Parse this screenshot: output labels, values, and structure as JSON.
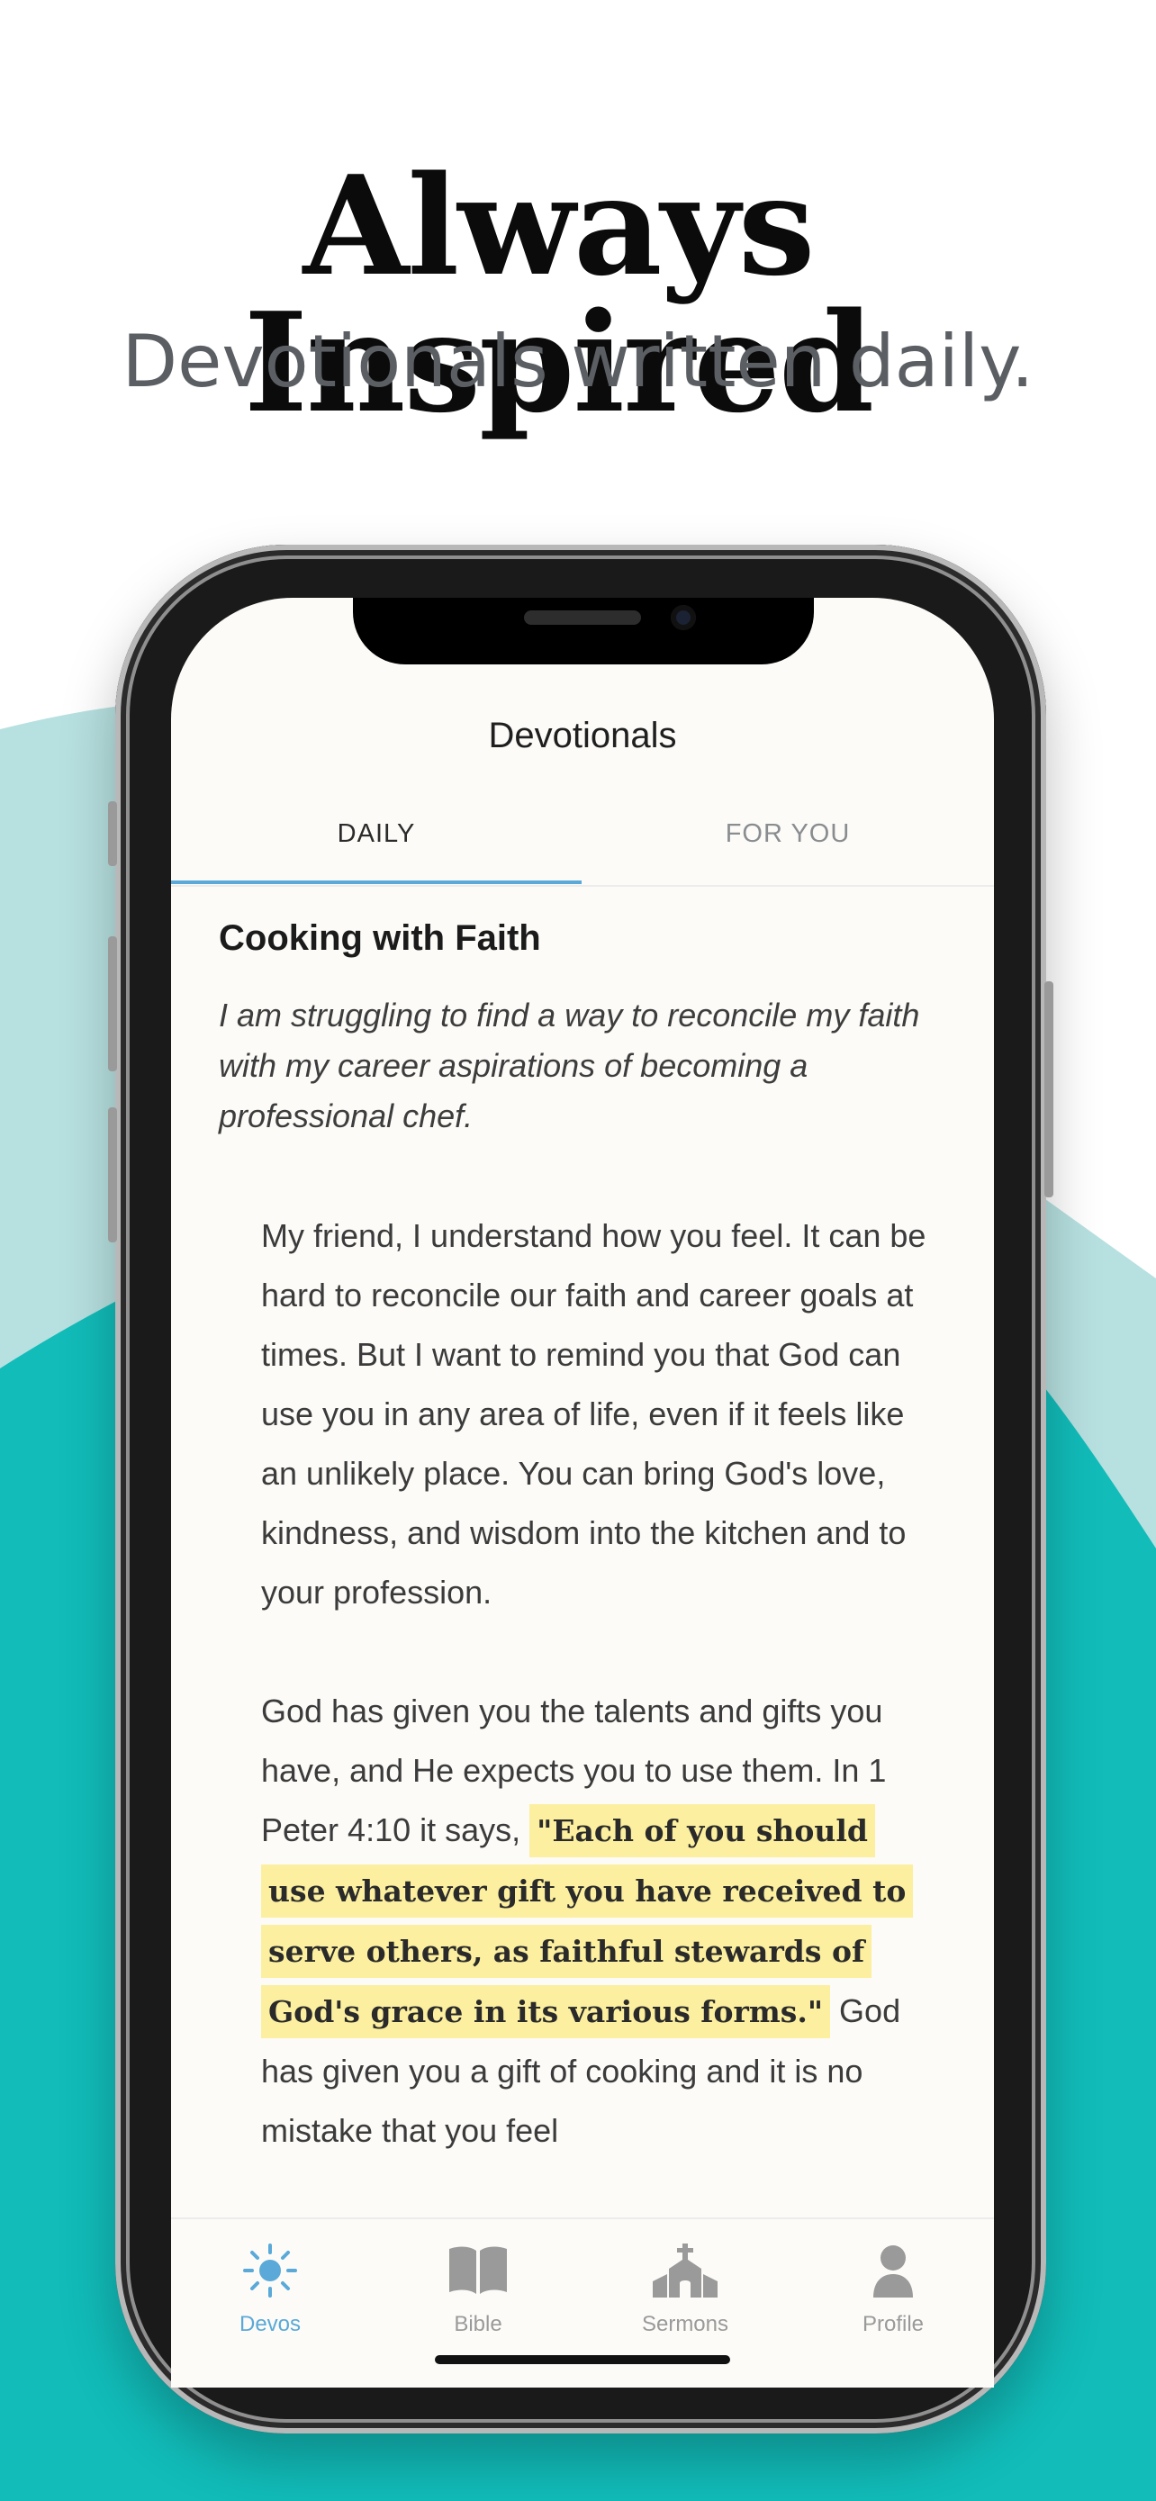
{
  "hero": {
    "title": "Always Inspired",
    "subtitle": "Devotionals written daily."
  },
  "screen": {
    "nav_title": "Devotionals",
    "tabs": [
      {
        "label": "DAILY",
        "active": true
      },
      {
        "label": "FOR YOU",
        "active": false
      }
    ],
    "devotional": {
      "title": "Cooking with Faith",
      "question": "I am struggling to find a way to reconcile my faith with my career aspirations of becoming a professional chef.",
      "paragraph1": "My friend, I understand how you feel. It can be hard to reconcile our faith and career goals at times. But I want to remind you that God can use you in any area of life, even if it feels like an unlikely place. You can bring God's love, kindness, and wisdom into the kitchen and to your profession.",
      "paragraph2_before": "God has given you the talents and gifts you have, and He expects you to use them. In 1 Peter 4:10 it says, ",
      "paragraph2_verse": "\"Each of you should use whatever gift you have received to serve others, as faithful stewards of God's grace in its various forms.\"",
      "paragraph2_after": " God has given you a gift of cooking and it is no mistake that you feel"
    },
    "tabbar": [
      {
        "label": "Devos",
        "icon": "sun-icon",
        "active": true
      },
      {
        "label": "Bible",
        "icon": "open-book-icon",
        "active": false
      },
      {
        "label": "Sermons",
        "icon": "church-icon",
        "active": false
      },
      {
        "label": "Profile",
        "icon": "person-icon",
        "active": false
      }
    ]
  },
  "colors": {
    "accent": "#5aa9d8",
    "teal_wave": "#11bcb9",
    "light_teal_wave": "#b7e0e0",
    "highlight": "#fcef9f"
  }
}
